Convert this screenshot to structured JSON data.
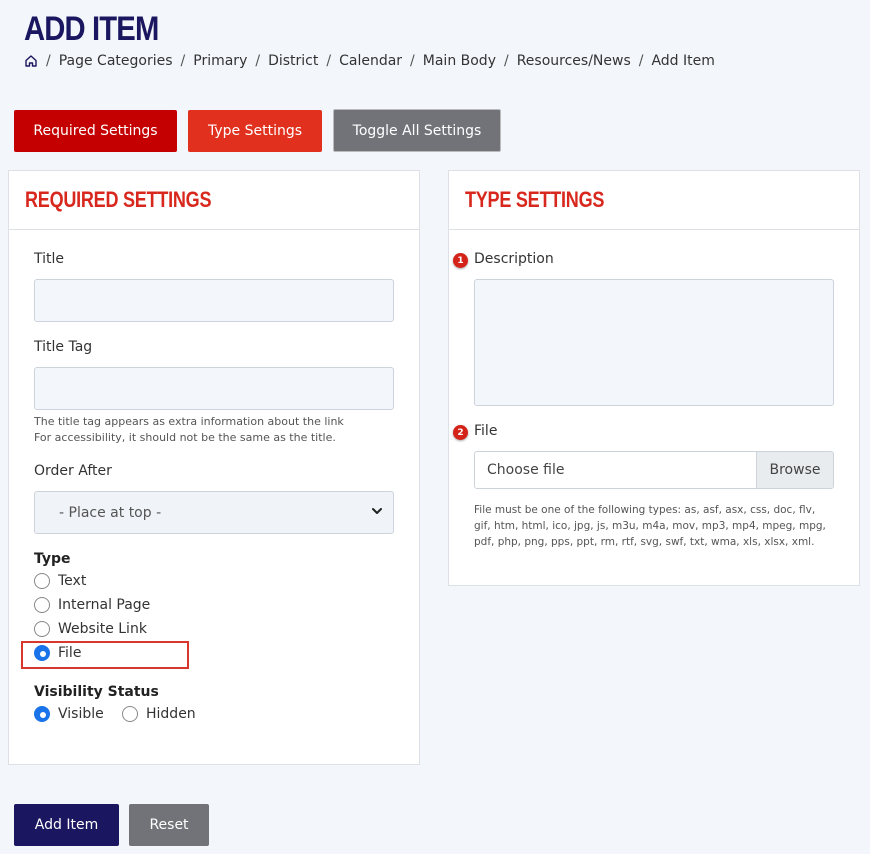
{
  "page": {
    "title": "ADD ITEM"
  },
  "breadcrumb": {
    "items": [
      "Page Categories",
      "Primary",
      "District",
      "Calendar",
      "Main Body",
      "Resources/News",
      "Add Item"
    ],
    "separator": "/"
  },
  "toolbar": {
    "required_label": "Required Settings",
    "type_label": "Type Settings",
    "toggle_label": "Toggle All Settings"
  },
  "required_settings": {
    "heading": "REQUIRED SETTINGS",
    "title_label": "Title",
    "title_value": "",
    "title_tag_label": "Title Tag",
    "title_tag_value": "",
    "title_tag_help_1": "The title tag appears as extra information about the link",
    "title_tag_help_2": "For accessibility, it should not be the same as the title.",
    "order_after_label": "Order After",
    "order_after_value": "- Place at top -",
    "type_label": "Type",
    "type_options": [
      "Text",
      "Internal Page",
      "Website Link",
      "File"
    ],
    "type_selected": "File",
    "visibility_label": "Visibility Status",
    "visibility_options": [
      "Visible",
      "Hidden"
    ],
    "visibility_selected": "Visible"
  },
  "type_settings": {
    "heading": "TYPE SETTINGS",
    "description_label": "Description",
    "description_badge": "1",
    "description_value": "",
    "file_label": "File",
    "file_badge": "2",
    "file_placeholder": "Choose file",
    "browse_label": "Browse",
    "file_help_1": "File must be one of the following types: as, asf, asx, css, doc, flv,",
    "file_help_2": "gif, htm, html, ico, jpg, js, m3u, m4a, mov, mp3, mp4, mpeg, mpg,",
    "file_help_3": "pdf, php, png, pps, ppt, rm, rtf, svg, swf, txt, wma, xls, xlsx, xml."
  },
  "footer": {
    "add_label": "Add Item",
    "reset_label": "Reset"
  },
  "colors": {
    "brand_navy": "#1b1660",
    "required_red": "#c40000",
    "type_red": "#e1301d",
    "heading_red": "#d8281e",
    "gray_button": "#717378",
    "radio_blue": "#1a73e8"
  }
}
